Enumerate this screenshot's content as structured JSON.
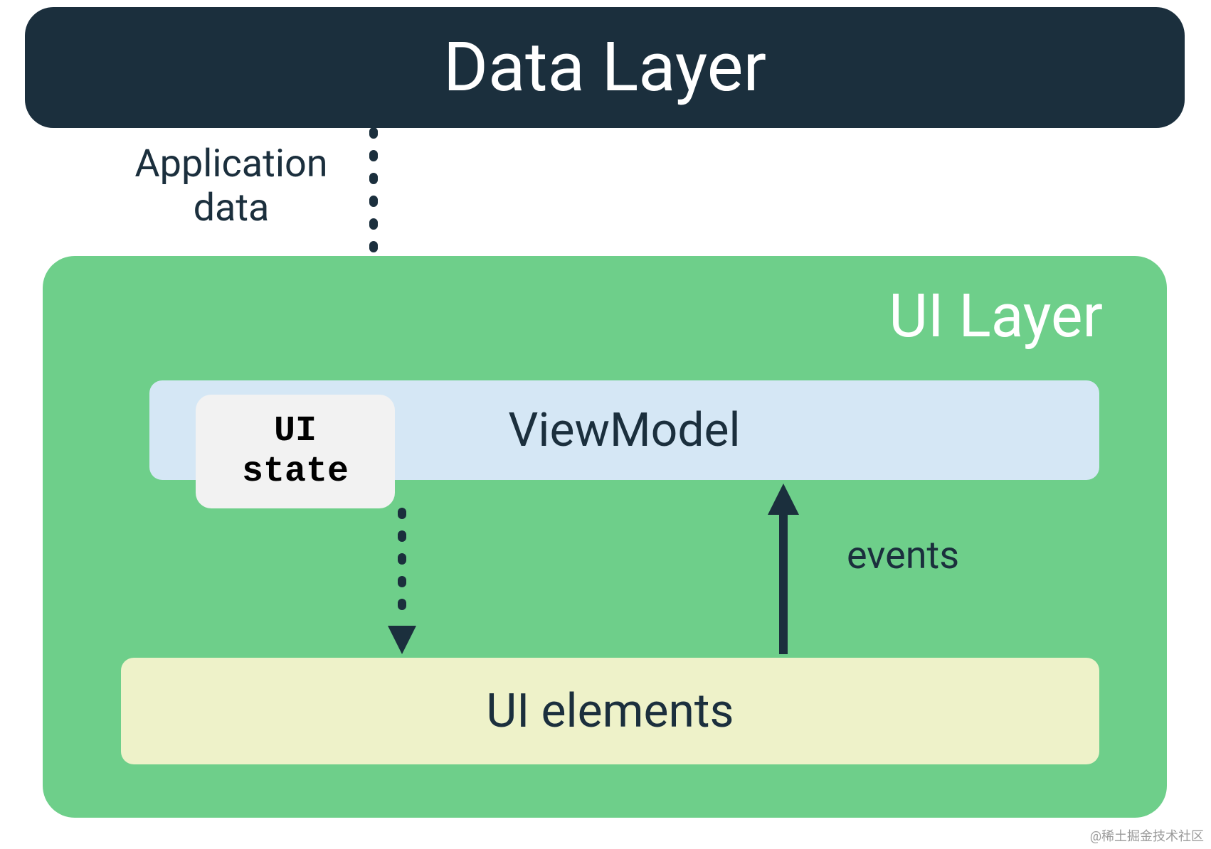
{
  "diagram": {
    "data_layer_title": "Data Layer",
    "app_data_label": "Application\ndata",
    "ui_layer_title": "UI Layer",
    "viewmodel_label": "ViewModel",
    "ui_state_label": "UI\nstate",
    "ui_elements_label": "UI elements",
    "events_label": "events",
    "watermark": "@稀土掘金技术社区"
  },
  "colors": {
    "dark": "#1b2f3d",
    "green": "#6ecf8a",
    "lightblue": "#d5e7f5",
    "cream": "#eef2c9",
    "gray": "#f2f2f2"
  }
}
